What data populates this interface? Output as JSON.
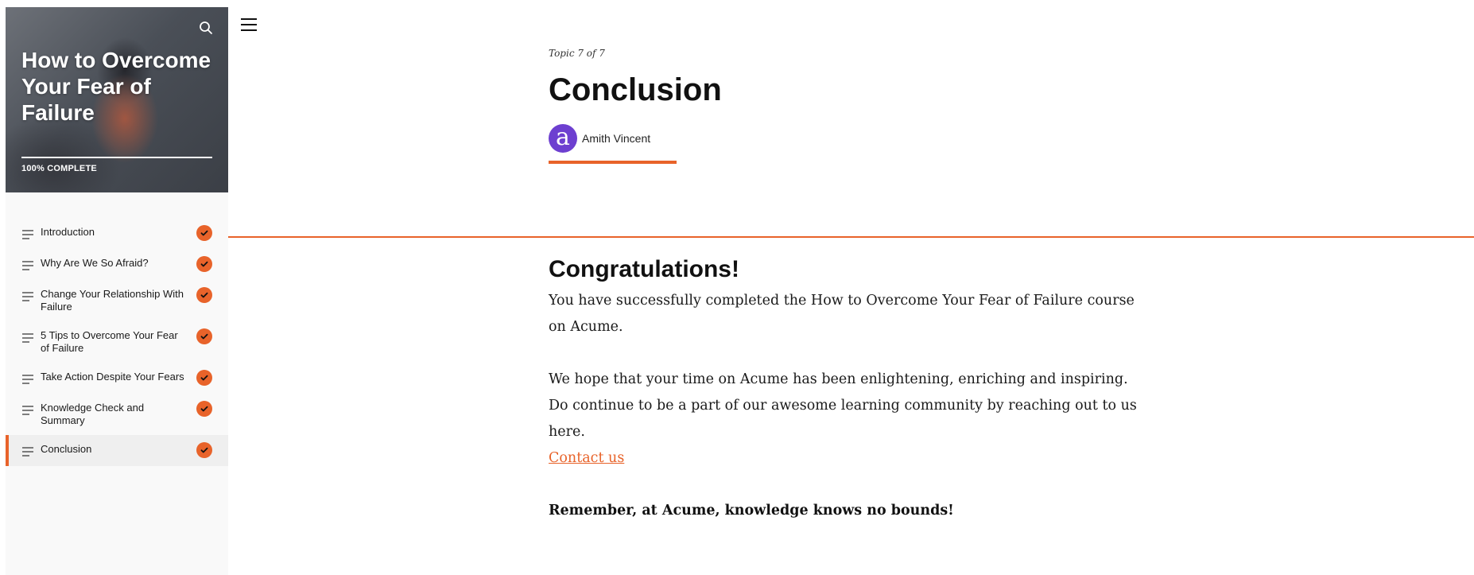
{
  "course": {
    "title": "How to Overcome Your Fear of Failure",
    "progress_text": "100% COMPLETE",
    "progress_fraction": 1.0
  },
  "sidebar": {
    "lessons": [
      {
        "label": "Introduction",
        "completed": true,
        "icon": "lines-icon"
      },
      {
        "label": "Why Are We So Afraid?",
        "completed": true,
        "icon": "lines-icon"
      },
      {
        "label": "Change Your Relationship With Failure",
        "completed": true,
        "icon": "lines-icon"
      },
      {
        "label": "5 Tips to Overcome Your Fear of Failure",
        "completed": true,
        "icon": "lines-icon"
      },
      {
        "label": "Take Action Despite Your Fears",
        "completed": true,
        "icon": "lines-icon"
      },
      {
        "label": "Knowledge Check and Summary",
        "completed": true,
        "icon": "lines-icon"
      },
      {
        "label": "Conclusion",
        "completed": true,
        "active": true,
        "icon": "lines-icon"
      }
    ]
  },
  "header": {
    "topic_count": "Topic 7 of 7",
    "lesson_title": "Conclusion",
    "author_initial": "a",
    "author_name": "Amith Vincent"
  },
  "content": {
    "heading": "Congratulations!",
    "para1": "You have successfully completed the How to Overcome Your Fear of Failure course on Acume.",
    "para2": "We hope that your time on Acume has been enlightening, enriching and inspiring. Do continue to be a part of our awesome learning community by reaching out to us here.",
    "link_text": "Contact us",
    "closing": "Remember, at Acume, knowledge knows no bounds!"
  },
  "colors": {
    "accent": "#e8632a",
    "avatar": "#6d3fd0"
  }
}
